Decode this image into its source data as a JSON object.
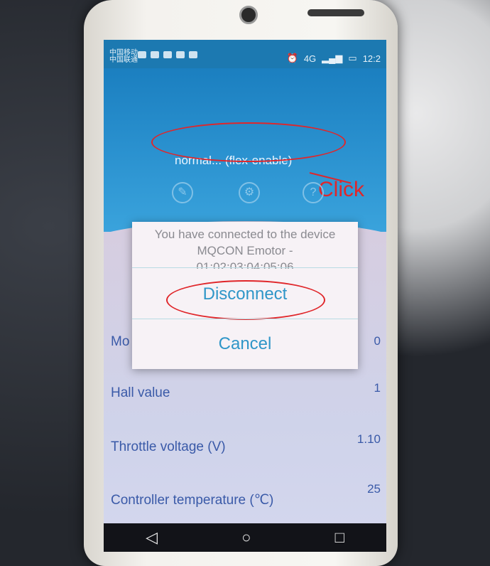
{
  "status": {
    "carrier": "中国移动",
    "carrier2": "中国联通",
    "network": "4G",
    "time": "12:2"
  },
  "header": {
    "mode_label": "normal... (flex-enable)",
    "annotation": "Click"
  },
  "dialog": {
    "message_line1": "You have connected to the device",
    "message_line2": "MQCON Emotor -",
    "message_line3": "01:02:03:04:05:06",
    "disconnect_label": "Disconnect",
    "cancel_label": "Cancel"
  },
  "rows": [
    {
      "label": "Mo",
      "value": "0"
    },
    {
      "label": "Hall value",
      "value": "1"
    },
    {
      "label": "Throttle voltage (V)",
      "value": "1.10"
    },
    {
      "label": "Controller temperature (℃)",
      "value": "25"
    }
  ],
  "nav": {
    "back": "◁",
    "home": "○",
    "recent": "□"
  }
}
